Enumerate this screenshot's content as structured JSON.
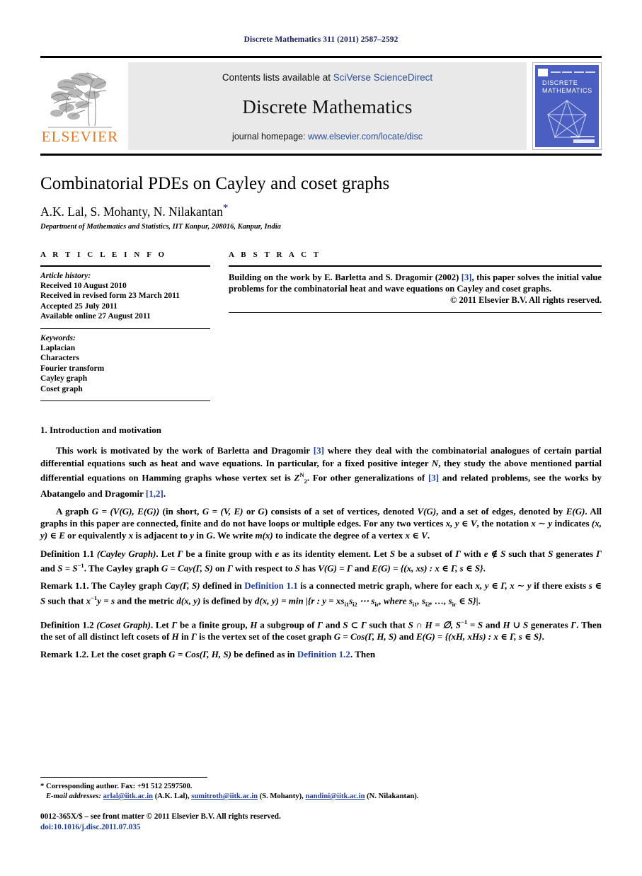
{
  "running_head": "Discrete Mathematics 311 (2011) 2587–2592",
  "masthead": {
    "publisher_name": "ELSEVIER",
    "contents_prefix": "Contents lists available at ",
    "contents_link": "SciVerse ScienceDirect",
    "journal_name": "Discrete Mathematics",
    "homepage_prefix": "journal homepage: ",
    "homepage_link": "www.elsevier.com/locate/disc",
    "cover_title_line1": "DISCRETE",
    "cover_title_line2": "MATHEMATICS",
    "cover_color": "#4a5fc1",
    "link_color": "#2b4f9e",
    "elsevier_orange": "#E87722"
  },
  "title_block": {
    "title": "Combinatorial PDEs on Cayley and coset graphs",
    "authors": "A.K. Lal, S. Mohanty, N. Nilakantan",
    "corresponding_marker": "*",
    "affiliation": "Department of Mathematics and Statistics, IIT Kanpur, 208016, Kanpur, India"
  },
  "article_info": {
    "label": "A R T I C L E   I N F O",
    "history_label": "Article history:",
    "history": [
      "Received 10 August 2010",
      "Received in revised form 23 March 2011",
      "Accepted 25 July 2011",
      "Available online 27 August 2011"
    ],
    "keywords_label": "Keywords:",
    "keywords": [
      "Laplacian",
      "Characters",
      "Fourier transform",
      "Cayley graph",
      "Coset graph"
    ]
  },
  "abstract": {
    "label": "A B S T R A C T",
    "text_part1": "Building on the work by E. Barletta and S. Dragomir (2002) ",
    "cite": "[3]",
    "text_part2": ", this paper solves the initial value problems for the combinatorial heat and wave equations on Cayley and coset graphs.",
    "copyright": "© 2011 Elsevier B.V. All rights reserved."
  },
  "body": {
    "section_number": "1.",
    "section_title": "Introduction and motivation",
    "para1": {
      "seg1": "This work is motivated by the work of Barletta and Dragomir ",
      "cite1": "[3]",
      "seg2": " where they deal with the combinatorial analogues of certain partial differential equations such as heat and wave equations. In particular, for a fixed positive integer ",
      "var_n": "N",
      "seg3": ", they study the above mentioned partial differential equations on Hamming graphs whose vertex set is ",
      "vertex_set": "Z",
      "vertex_sup": "N",
      "vertex_sub": "2",
      "seg4": ". For other generalizations of ",
      "cite2": "[3]",
      "seg5": " and related problems, see the works by Abatangelo and Dragomir ",
      "cite3": "[1,2]",
      "seg6": "."
    },
    "para2": {
      "seg1": "A graph ",
      "m1": "G = (V(G), E(G))",
      "seg2": " (in short, ",
      "m2": "G = (V, E)",
      "seg3": " or ",
      "m3": "G",
      "seg4": ") consists of a set of vertices, denoted ",
      "m4": "V(G)",
      "seg5": ", and a set of edges, denoted by ",
      "m5": "E(G)",
      "seg6": ". All graphs in this paper are connected, finite and do not have loops or multiple edges. For any two vertices ",
      "m6": "x, y ∈ V",
      "seg7": ", the notation ",
      "m7": "x ∼ y",
      "seg8": " indicates ",
      "m8": "(x, y) ∈ E",
      "seg9": " or equivalently ",
      "m9": "x",
      "seg10": " is adjacent to ",
      "m10": "y",
      "seg11": " in ",
      "m11": "G",
      "seg12": ". We write ",
      "m12": "m(x)",
      "seg13": " to indicate the degree of a vertex ",
      "m13": "x ∈ V",
      "seg14": "."
    },
    "definition_1_1": {
      "head": "Definition 1.1",
      "kind": "(Cayley Graph)",
      "text1": ". Let ",
      "g1": "Γ",
      "text2": " be a finite group with ",
      "g2": "e",
      "text3": " as its identity element. Let ",
      "g3": "S",
      "text4": " be a subset of ",
      "g4": "Γ",
      "text5": " with ",
      "g5": "e ∉ S",
      "text6": " such that ",
      "g6": "S",
      "text7": " generates ",
      "g7": "Γ",
      "text8": " and ",
      "g8": "S = S",
      "g8sup": "−1",
      "text9": ". The Cayley graph ",
      "g9": "G = Cay(Γ, S)",
      "text10": " on ",
      "g10": "Γ",
      "text11": " with respect to ",
      "g11": "S",
      "text12": " has ",
      "g12": "V(G) = Γ",
      "text13": " and ",
      "g13": "E(G) = {(x, xs) : x ∈ Γ, s ∈ S}",
      "text14": "."
    },
    "remark_1_1": {
      "head": "Remark 1.1",
      "text1": ". The Cayley graph ",
      "m1": "Cay(Γ, S)",
      "text2": " defined in ",
      "xref": "Definition 1.1",
      "text3": " is a connected metric graph, where for each ",
      "m2": "x, y ∈ Γ, x ∼ y",
      "text4": " if there exists ",
      "m3": "s ∈ S",
      "text5": " such that ",
      "m4": "x",
      "m4sup": "−1",
      "m4b": "y = s",
      "text6": " and the metric ",
      "m5": "d(x, y)",
      "text7": " is defined by ",
      "m6": "d(x, y) = min |{r : y = xs",
      "m6sub1": "i1",
      "m6b": "s",
      "m6sub2": "i2",
      "m6c": " ⋯ s",
      "m6sub3": "ir",
      "m6d": ", where s",
      "m6sub4": "i1",
      "m6e": ", s",
      "m6sub5": "i2",
      "m6f": ", …, s",
      "m6sub6": "ir",
      "m6g": " ∈ S}|",
      "text8": "."
    },
    "definition_1_2": {
      "head": "Definition 1.2",
      "kind": "(Coset Graph)",
      "text1": ". Let ",
      "g1": "Γ",
      "text2": " be a finite group, ",
      "g2": "H",
      "text3": " a subgroup of ",
      "g3": "Γ",
      "text4": " and ",
      "g4": "S ⊂ Γ",
      "text5": " such that ",
      "g5": "S ∩ H = ∅, S",
      "g5sup": "−1",
      "g5b": " = S",
      "text6": " and ",
      "g6": "H ∪ S",
      "text7": " generates ",
      "g7": "Γ",
      "text8": ". Then the set of all distinct left cosets of ",
      "g8": "H",
      "text9": " in ",
      "g9": "Γ",
      "text10": " is the vertex set of the coset graph ",
      "g10": "G = Cos(Γ, H, S)",
      "text11": " and ",
      "g11": "E(G) = {(xH, xHs) : x ∈ Γ, s ∈ S}",
      "text12": "."
    },
    "remark_1_2": {
      "head": "Remark 1.2",
      "text1": ". Let the coset graph ",
      "m1": "G = Cos(Γ, H, S)",
      "text2": " be defined as in ",
      "xref": "Definition 1.2",
      "text3": ". Then"
    }
  },
  "footer": {
    "corresponding": "* Corresponding author. Fax: +91 512 2597500.",
    "email_label": "E-mail addresses:",
    "emails": [
      {
        "address": "arlal@iitk.ac.in",
        "person": " (A.K. Lal), "
      },
      {
        "address": "sumitroth@iitk.ac.in",
        "person": " (S. Mohanty), "
      },
      {
        "address": "nandini@iitk.ac.in",
        "person": " (N. Nilakantan)."
      }
    ],
    "issn": "0012-365X/$ – see front matter © 2011 Elsevier B.V. All rights reserved.",
    "doi": "doi:10.1016/j.disc.2011.07.035"
  }
}
